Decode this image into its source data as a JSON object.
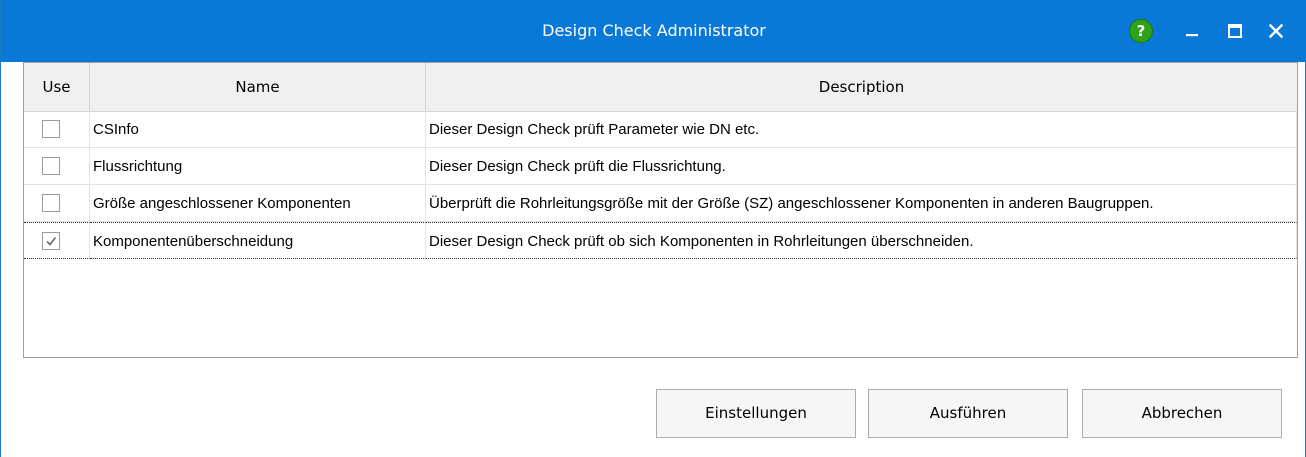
{
  "window": {
    "title": "Design Check Administrator"
  },
  "titlebar_icons": [
    "help-icon",
    "minimize-icon",
    "maximize-icon",
    "close-icon"
  ],
  "colors": {
    "titlebar": "#0a78d7",
    "help": "#2fa11a"
  },
  "table": {
    "headers": {
      "use": "Use",
      "name": "Name",
      "description": "Description"
    },
    "rows": [
      {
        "checked": false,
        "name": "CSInfo",
        "description": "Dieser Design Check prüft Parameter wie DN etc."
      },
      {
        "checked": false,
        "name": "Flussrichtung",
        "description": "Dieser Design Check prüft die Flussrichtung."
      },
      {
        "checked": false,
        "name": "Größe angeschlossener Komponenten",
        "description": "Überprüft die Rohrleitungsgröße mit der Größe (SZ) angeschlossener Komponenten in anderen Baugruppen."
      },
      {
        "checked": true,
        "name": "Komponentenüberschneidung",
        "description": "Dieser Design Check prüft ob sich Komponenten in Rohrleitungen überschneiden."
      }
    ]
  },
  "buttons": {
    "settings": "Einstellungen",
    "run": "Ausführen",
    "cancel": "Abbrechen"
  }
}
